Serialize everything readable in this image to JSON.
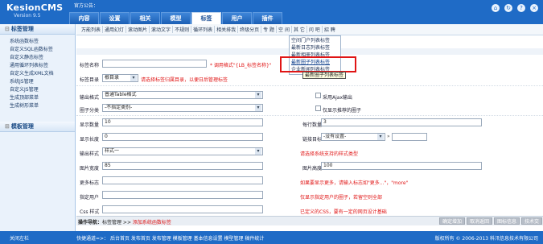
{
  "header": {
    "logo": "KesionCMS",
    "version": "Version 9.5",
    "welcome": "官方公告：",
    "tabs": [
      "内容",
      "设置",
      "相关",
      "模型",
      "标签",
      "用户",
      "插件"
    ],
    "active_tab": "标签",
    "icons": [
      "home-icon",
      "refresh-icon",
      "help-icon",
      "exit-icon"
    ]
  },
  "sidebar": {
    "section1": "标签管理",
    "items": [
      "系统函数标签",
      "自定义SQL函数标签",
      "自定义静态标签",
      "通用循环列表标签",
      "自定义生成XML文档",
      "系统JS管理",
      "自定义JS管理",
      "生成顶部菜单",
      "生成树形菜单"
    ],
    "section2": "模板管理",
    "collapse_symbol": "⊟",
    "expand_symbol": "⊞"
  },
  "toolbar": {
    "items": [
      "万能列表",
      "通用幻灯",
      "滚动图片",
      "滚动文字",
      "不规则",
      "循环列表",
      "相关排我",
      "终级分页",
      "专 题",
      "空 间",
      "其 它",
      "问 吧",
      "招 聘"
    ]
  },
  "menu": {
    "items": [
      "空间门户列表标签",
      "最新日志列表标签",
      "最新相册列表标签",
      "最新圈子列表标签",
      "企业新闻列表标签"
    ],
    "hover_index": 3,
    "tooltip": "最新圈子列表标签"
  },
  "form": {
    "tag_name_label": "标签名称",
    "tag_name_value": "",
    "tag_name_hint": "* 调用格式\"{LB_标签名称}\"",
    "tag_dir_label": "标签目录",
    "tag_dir_value": "根目录",
    "tag_dir_hint": "请选择标签归属目录，以便日后管理标签",
    "output_format_label": "输出格式",
    "output_format_value": "普通Table格式",
    "ajax_label": "采用Ajax输出",
    "circle_type_label": "圈子分类",
    "circle_type_value": "-不指定类别-",
    "recommend_label": "仅显示推荐的圈子",
    "count_label": "显示数量",
    "count_value": "10",
    "rows_label": "每行数量",
    "rows_value": "3",
    "length_label": "显示长度",
    "length_value": "0",
    "target_label": "链接目标",
    "target_value": "-没有设置-",
    "target_extra": "",
    "output_style_label": "输出样式",
    "output_style_value": "样式一",
    "output_style_hint": "请选择系统支持的样式类型",
    "img_width_label": "图片宽度",
    "img_width_value": "85",
    "img_height_label": "图片高度",
    "img_height_value": "100",
    "more_label": "更多标志",
    "more_value": "",
    "more_hint": "如果要显示更多，请输入标志如\"更多...\"，\"more\"",
    "user_label": "指定用户",
    "user_value": "",
    "user_hint": "仅显示指定用户的圈子，若留空则全部",
    "css_label": "Css 样式",
    "css_value": "",
    "css_hint": "已定义的CSS，要有一定的网页设计基础"
  },
  "statusbar": {
    "prefix": "操作导航：",
    "path": "标签管理 >> ",
    "current": "添加系统函数标签",
    "buttons": [
      "确定增加",
      "取消返回",
      "图标信息",
      "技术交"
    ]
  },
  "footer": {
    "left": "关闭左栏",
    "links": "快捷通道=>：  后台首页  发布首页  发布管理  模板管理  基本信息设置  模型管理  稿件统计",
    "right": "版权所有 © 2006-2013 科汛信息技术有限公司"
  }
}
